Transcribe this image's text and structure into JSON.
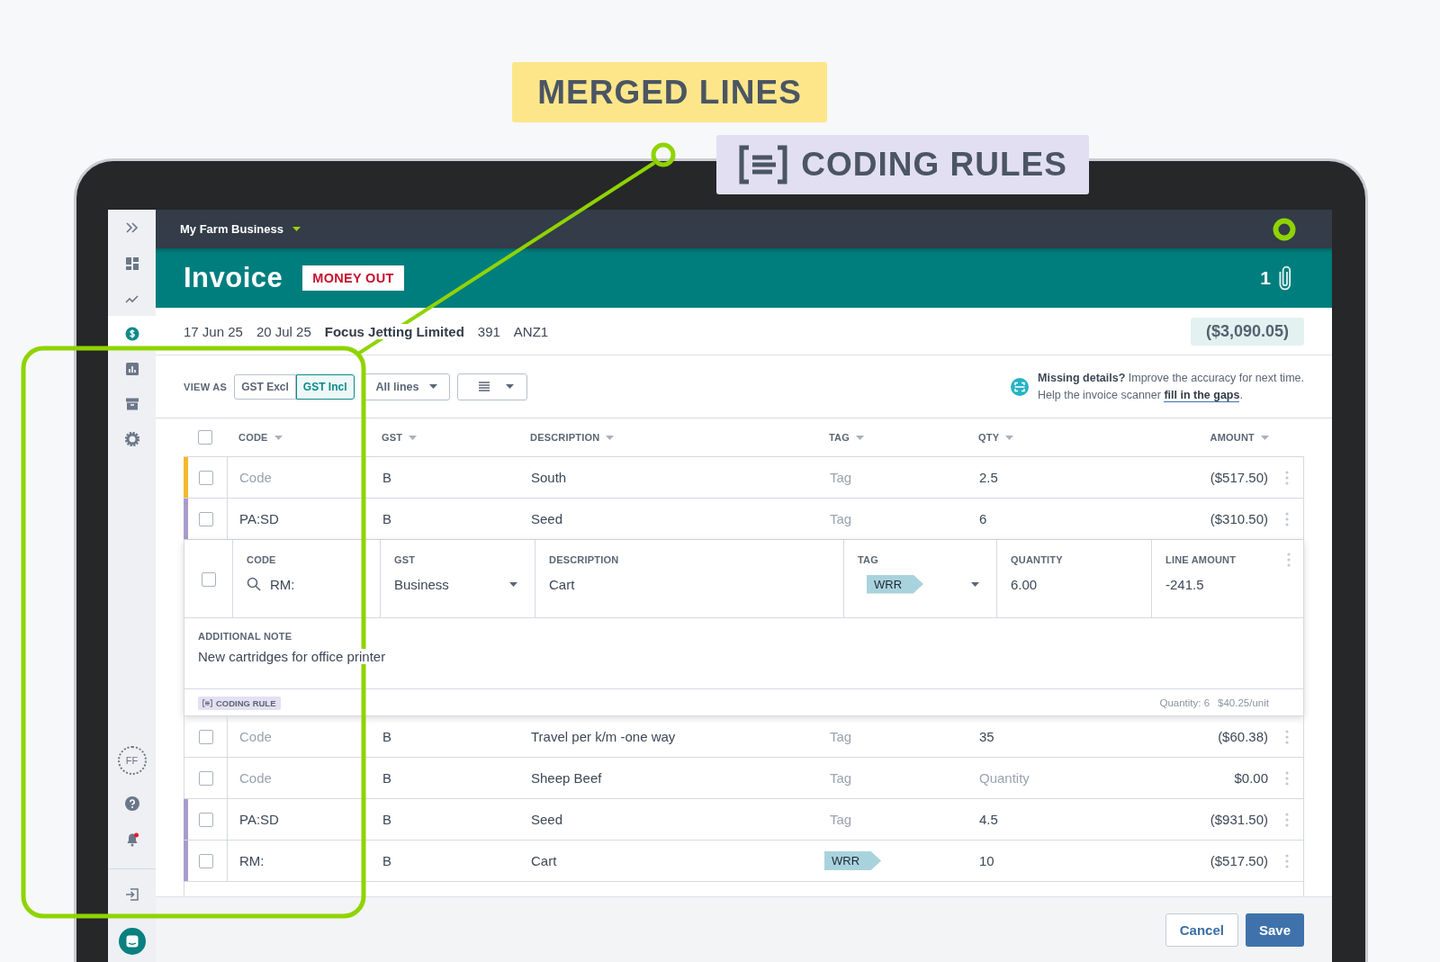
{
  "callouts": [
    {
      "kind": "plain",
      "text": "MERGED LINES"
    },
    {
      "kind": "with_icon",
      "text": "CODING RULES"
    }
  ],
  "sidebar": {
    "nav": [
      {
        "kind": "expand",
        "selected": false
      },
      {
        "kind": "dashboard",
        "selected": false
      },
      {
        "kind": "trend",
        "selected": false
      },
      {
        "kind": "money",
        "selected": true
      },
      {
        "kind": "report",
        "selected": false
      },
      {
        "kind": "archive",
        "selected": false
      },
      {
        "kind": "settings",
        "selected": false
      }
    ],
    "avatar": "FF",
    "notifications_unread": true
  },
  "topbar": {
    "organisation": "My Farm Business"
  },
  "header": {
    "title": "Invoice",
    "badge": "MONEY OUT",
    "attachments": "1"
  },
  "summary": {
    "fields": [
      {
        "text": "17 Jun 25",
        "emphasis": false
      },
      {
        "text": "20 Jul 25",
        "emphasis": false
      },
      {
        "text": "Focus Jetting Limited",
        "emphasis": true
      },
      {
        "text": "391",
        "emphasis": false
      },
      {
        "text": "ANZ1",
        "emphasis": false
      }
    ],
    "total": "($3,090.05)"
  },
  "toolbar": {
    "view_as": "VIEW AS",
    "view_options": [
      {
        "label": "GST Excl",
        "selected": false
      },
      {
        "label": "GST Incl",
        "selected": true
      }
    ],
    "filter": "All lines",
    "hint": {
      "line1": "**Missing details?** Improve the accuracy for next time.",
      "line2": "Help the invoice scanner",
      "link": "fill in the gaps",
      "end": "."
    }
  },
  "table": {
    "header_checked": false,
    "columns": [
      "CODE",
      "GST",
      "DESCRIPTION",
      "TAG",
      "QTY",
      "AMOUNT"
    ],
    "lines": [
      {
        "kind": "row",
        "checked": false,
        "color": "#f4b92c",
        "code": {
          "placeholder": "Code"
        },
        "gst": "B",
        "description": "South",
        "tag": {
          "placeholder": "Tag"
        },
        "qty": {
          "value": "2.5"
        },
        "amount": "($517.50)"
      },
      {
        "kind": "row",
        "checked": false,
        "color": "#a99ccb",
        "code": {
          "value": "PA:SD"
        },
        "gst": "B",
        "description": "Seed",
        "tag": {
          "placeholder": "Tag"
        },
        "qty": {
          "value": "6"
        },
        "amount": "($310.50)"
      },
      {
        "kind": "expanded",
        "checked": false,
        "fields": [
          {
            "kind": "search",
            "label": "CODE",
            "value": "RM:"
          },
          {
            "kind": "dropdown",
            "label": "GST",
            "value": "Business"
          },
          {
            "kind": "text",
            "label": "DESCRIPTION",
            "value": "Cart"
          },
          {
            "kind": "tag_dropdown",
            "label": "TAG",
            "value": "WRR"
          },
          {
            "kind": "text",
            "label": "QUANTITY",
            "value": "6.00"
          },
          {
            "kind": "text",
            "label": "LINE AMOUNT",
            "value": "-241.5"
          }
        ],
        "note": {
          "label": "ADDITIONAL NOTE",
          "text": "New cartridges for office printer"
        },
        "rule_badge": "CODING RULE",
        "quantity_note": "Quantity: 6",
        "unit_price": "$40.25/unit"
      },
      {
        "kind": "row",
        "checked": false,
        "code": {
          "placeholder": "Code"
        },
        "gst": "B",
        "description": "Travel per k/m -one way",
        "tag": {
          "placeholder": "Tag"
        },
        "qty": {
          "value": "35"
        },
        "amount": "($60.38)"
      },
      {
        "kind": "row",
        "checked": false,
        "code": {
          "placeholder": "Code"
        },
        "gst": "B",
        "description": "Sheep Beef",
        "tag": {
          "placeholder": "Tag"
        },
        "qty": {
          "placeholder": "Quantity"
        },
        "amount": "$0.00"
      },
      {
        "kind": "row",
        "checked": false,
        "color": "#a99ccb",
        "code": {
          "value": "PA:SD"
        },
        "gst": "B",
        "description": "Seed",
        "tag": {
          "placeholder": "Tag"
        },
        "qty": {
          "value": "4.5"
        },
        "amount": "($931.50)"
      },
      {
        "kind": "row",
        "checked": false,
        "color": "#a99ccb",
        "code": {
          "value": "RM:"
        },
        "gst": "B",
        "description": "Cart",
        "tag": {
          "chip": "WRR"
        },
        "qty": {
          "value": "10"
        },
        "amount": "($517.50)"
      }
    ]
  },
  "footer": {
    "buttons": [
      {
        "kind": "secondary",
        "label": "Cancel"
      },
      {
        "kind": "primary",
        "label": "Save"
      }
    ]
  }
}
